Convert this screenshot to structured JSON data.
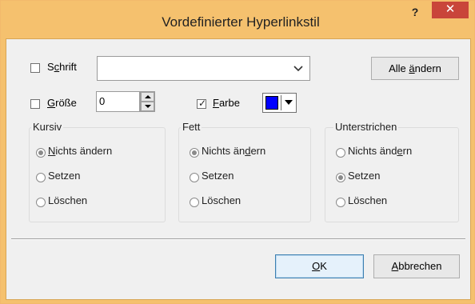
{
  "window": {
    "title": "Vordefinierter Hyperlinkstil",
    "help_label": "?",
    "close_label": "✕",
    "title_bar_color": "#f5c16e"
  },
  "font_row": {
    "checked": false,
    "label_pre": "S",
    "label_ul": "c",
    "label_post": "hrift",
    "value": "",
    "change_all_pre": "Alle ",
    "change_all_ul": "ä",
    "change_all_post": "ndern"
  },
  "size_row": {
    "checked": false,
    "label_ul": "G",
    "label_post": "röße",
    "value": "0"
  },
  "color_row": {
    "checked": true,
    "label_ul": "F",
    "label_post": "arbe",
    "color_value": "#0000ff"
  },
  "groups": [
    {
      "title": "Kursiv",
      "options": [
        {
          "label_ul": "N",
          "label_post": "ichts ändern",
          "selected": true
        },
        {
          "label": "Setzen",
          "selected": false
        },
        {
          "label": "Löschen",
          "selected": false
        }
      ]
    },
    {
      "title": "Fett",
      "options": [
        {
          "label_pre": "Nichts än",
          "label_ul": "d",
          "label_post": "ern",
          "selected": true
        },
        {
          "label": "Setzen",
          "selected": false
        },
        {
          "label": "Löschen",
          "selected": false
        }
      ]
    },
    {
      "title": "Unterstrichen",
      "options": [
        {
          "label_pre": "Nichts änd",
          "label_ul": "e",
          "label_post": "rn",
          "selected": false
        },
        {
          "label": "Setzen",
          "selected": true
        },
        {
          "label": "Löschen",
          "selected": false
        }
      ]
    }
  ],
  "buttons": {
    "ok_ul": "O",
    "ok_post": "K",
    "cancel_ul": "A",
    "cancel_post": "bbrechen"
  }
}
